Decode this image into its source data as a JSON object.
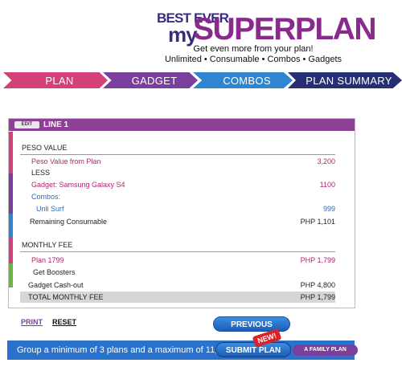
{
  "brand": {
    "best_ever": "BEST EVER",
    "my": "my",
    "superplan": "SUPERPLAN",
    "tagline": "Get even more from your plan!",
    "tagline2": "Unlimited • Consumable • Combos • Gadgets",
    "colors": {
      "purple": "#7a3e9c",
      "magenta": "#d3407a",
      "blue": "#2f86d0",
      "navy": "#262f74"
    }
  },
  "steps": [
    {
      "label": "PLAN"
    },
    {
      "label": "GADGET"
    },
    {
      "label": "COMBOS"
    },
    {
      "label": "PLAN SUMMARY"
    }
  ],
  "card": {
    "edit_label": "EDIT",
    "line_title": "LINE 1",
    "peso_header": "PESO VALUE",
    "peso_from_plan_label": "Peso Value from Plan",
    "peso_from_plan_value": "3,200",
    "less_label": "LESS",
    "gadget_label": "Gadget: Samsung Galaxy S4",
    "gadget_value": "1100",
    "combos_label": "Combos:",
    "combo_item_label": "Unli Surf",
    "combo_item_value": "999",
    "remaining_label": "Remaining Consumable",
    "remaining_value": "PHP 1,101",
    "monthly_header": "MONTHLY FEE",
    "plan_label": "Plan 1799",
    "plan_value": "PHP 1,799",
    "boosters_label": "Get Boosters",
    "cashout_label": "Gadget Cash-out",
    "cashout_value": "PHP 4,800",
    "total_label": "TOTAL MONTHLY FEE",
    "total_value": "PHP 1,799"
  },
  "actions": {
    "print": "PRINT",
    "reset": "RESET",
    "previous": "PREVIOUS",
    "submit": "SUBMIT PLAN",
    "new_badge": "NEW!",
    "family_plan": "A FAMILY PLAN"
  },
  "banner": {
    "text": "Group a minimum of 3 plans and a maximum of 11, all"
  }
}
